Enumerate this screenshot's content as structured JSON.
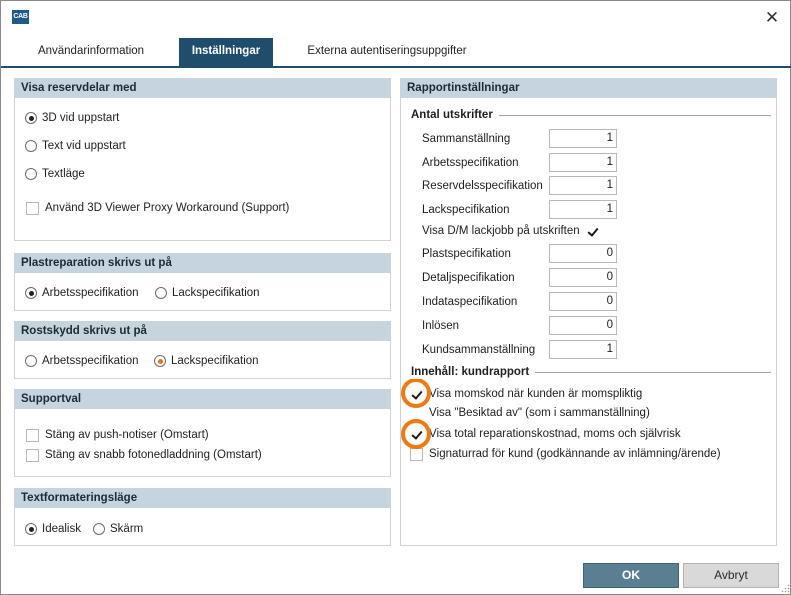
{
  "window": {
    "logo_text": "CAB",
    "close_glyph": "✕"
  },
  "tabs": [
    {
      "label": "Användarinformation"
    },
    {
      "label": "Inställningar"
    },
    {
      "label": "Externa autentiseringsuppgifter"
    }
  ],
  "left": {
    "visa_reservdelar": {
      "title": "Visa reservdelar med",
      "options": [
        "3D vid uppstart",
        "Text vid uppstart",
        "Textläge"
      ],
      "selected": "3D vid uppstart",
      "checkbox_label": "Använd 3D Viewer Proxy Workaround (Support)",
      "checkbox_checked": false
    },
    "plastreparation": {
      "title": "Plastreparation skrivs ut på",
      "options": [
        "Arbetsspecifikation",
        "Lackspecifikation"
      ],
      "selected": "Arbetsspecifikation"
    },
    "rostskydd": {
      "title": "Rostskydd skrivs ut på",
      "options": [
        "Arbetsspecifikation",
        "Lackspecifikation"
      ],
      "selected": "Lackspecifikation"
    },
    "supportval": {
      "title": "Supportval",
      "checkboxes": [
        {
          "label": "Stäng av push-notiser (Omstart)",
          "checked": false
        },
        {
          "label": "Stäng av snabb fotonedladdning (Omstart)",
          "checked": false
        }
      ]
    },
    "textformatering": {
      "title": "Textformateringsläge",
      "options": [
        "Idealisk",
        "Skärm"
      ],
      "selected": "Idealisk"
    }
  },
  "right": {
    "title": "Rapportinställningar",
    "antal": {
      "title": "Antal utskrifter",
      "rows": [
        {
          "label": "Sammanställning",
          "value": "1"
        },
        {
          "label": "Arbetsspecifikation",
          "value": "1"
        },
        {
          "label": "Reservdelsspecifikation",
          "value": "1"
        },
        {
          "label": "Lackspecifikation",
          "value": "1"
        }
      ],
      "dm_label": "Visa D/M lackjobb på utskriften",
      "dm_checked": true,
      "rows2": [
        {
          "label": "Plastspecifikation",
          "value": "0"
        },
        {
          "label": "Detaljspecifikation",
          "value": "0"
        },
        {
          "label": "Indataspecifikation",
          "value": "0"
        },
        {
          "label": "Inlösen",
          "value": "0"
        },
        {
          "label": "Kundsammanställning",
          "value": "1"
        }
      ]
    },
    "innehall": {
      "title": "Innehåll: kundrapport",
      "checkboxes": [
        {
          "label": "Visa momskod när kunden är momspliktig",
          "checked": true
        },
        {
          "label": "Visa \"Besiktad av\" (som i sammanställning)",
          "checked": false
        },
        {
          "label": "Visa total reparationskostnad, moms och självrisk",
          "checked": true
        },
        {
          "label": "Signaturrad för kund (godkännande av inlämning/ärende)",
          "checked": false
        }
      ]
    }
  },
  "buttons": {
    "ok": "OK",
    "cancel": "Avbryt"
  },
  "colors": {
    "tab_active": "#1e4e6c",
    "group_header": "#c5d4de",
    "highlight": "#f07a12",
    "ok_button": "#5a7f93"
  }
}
